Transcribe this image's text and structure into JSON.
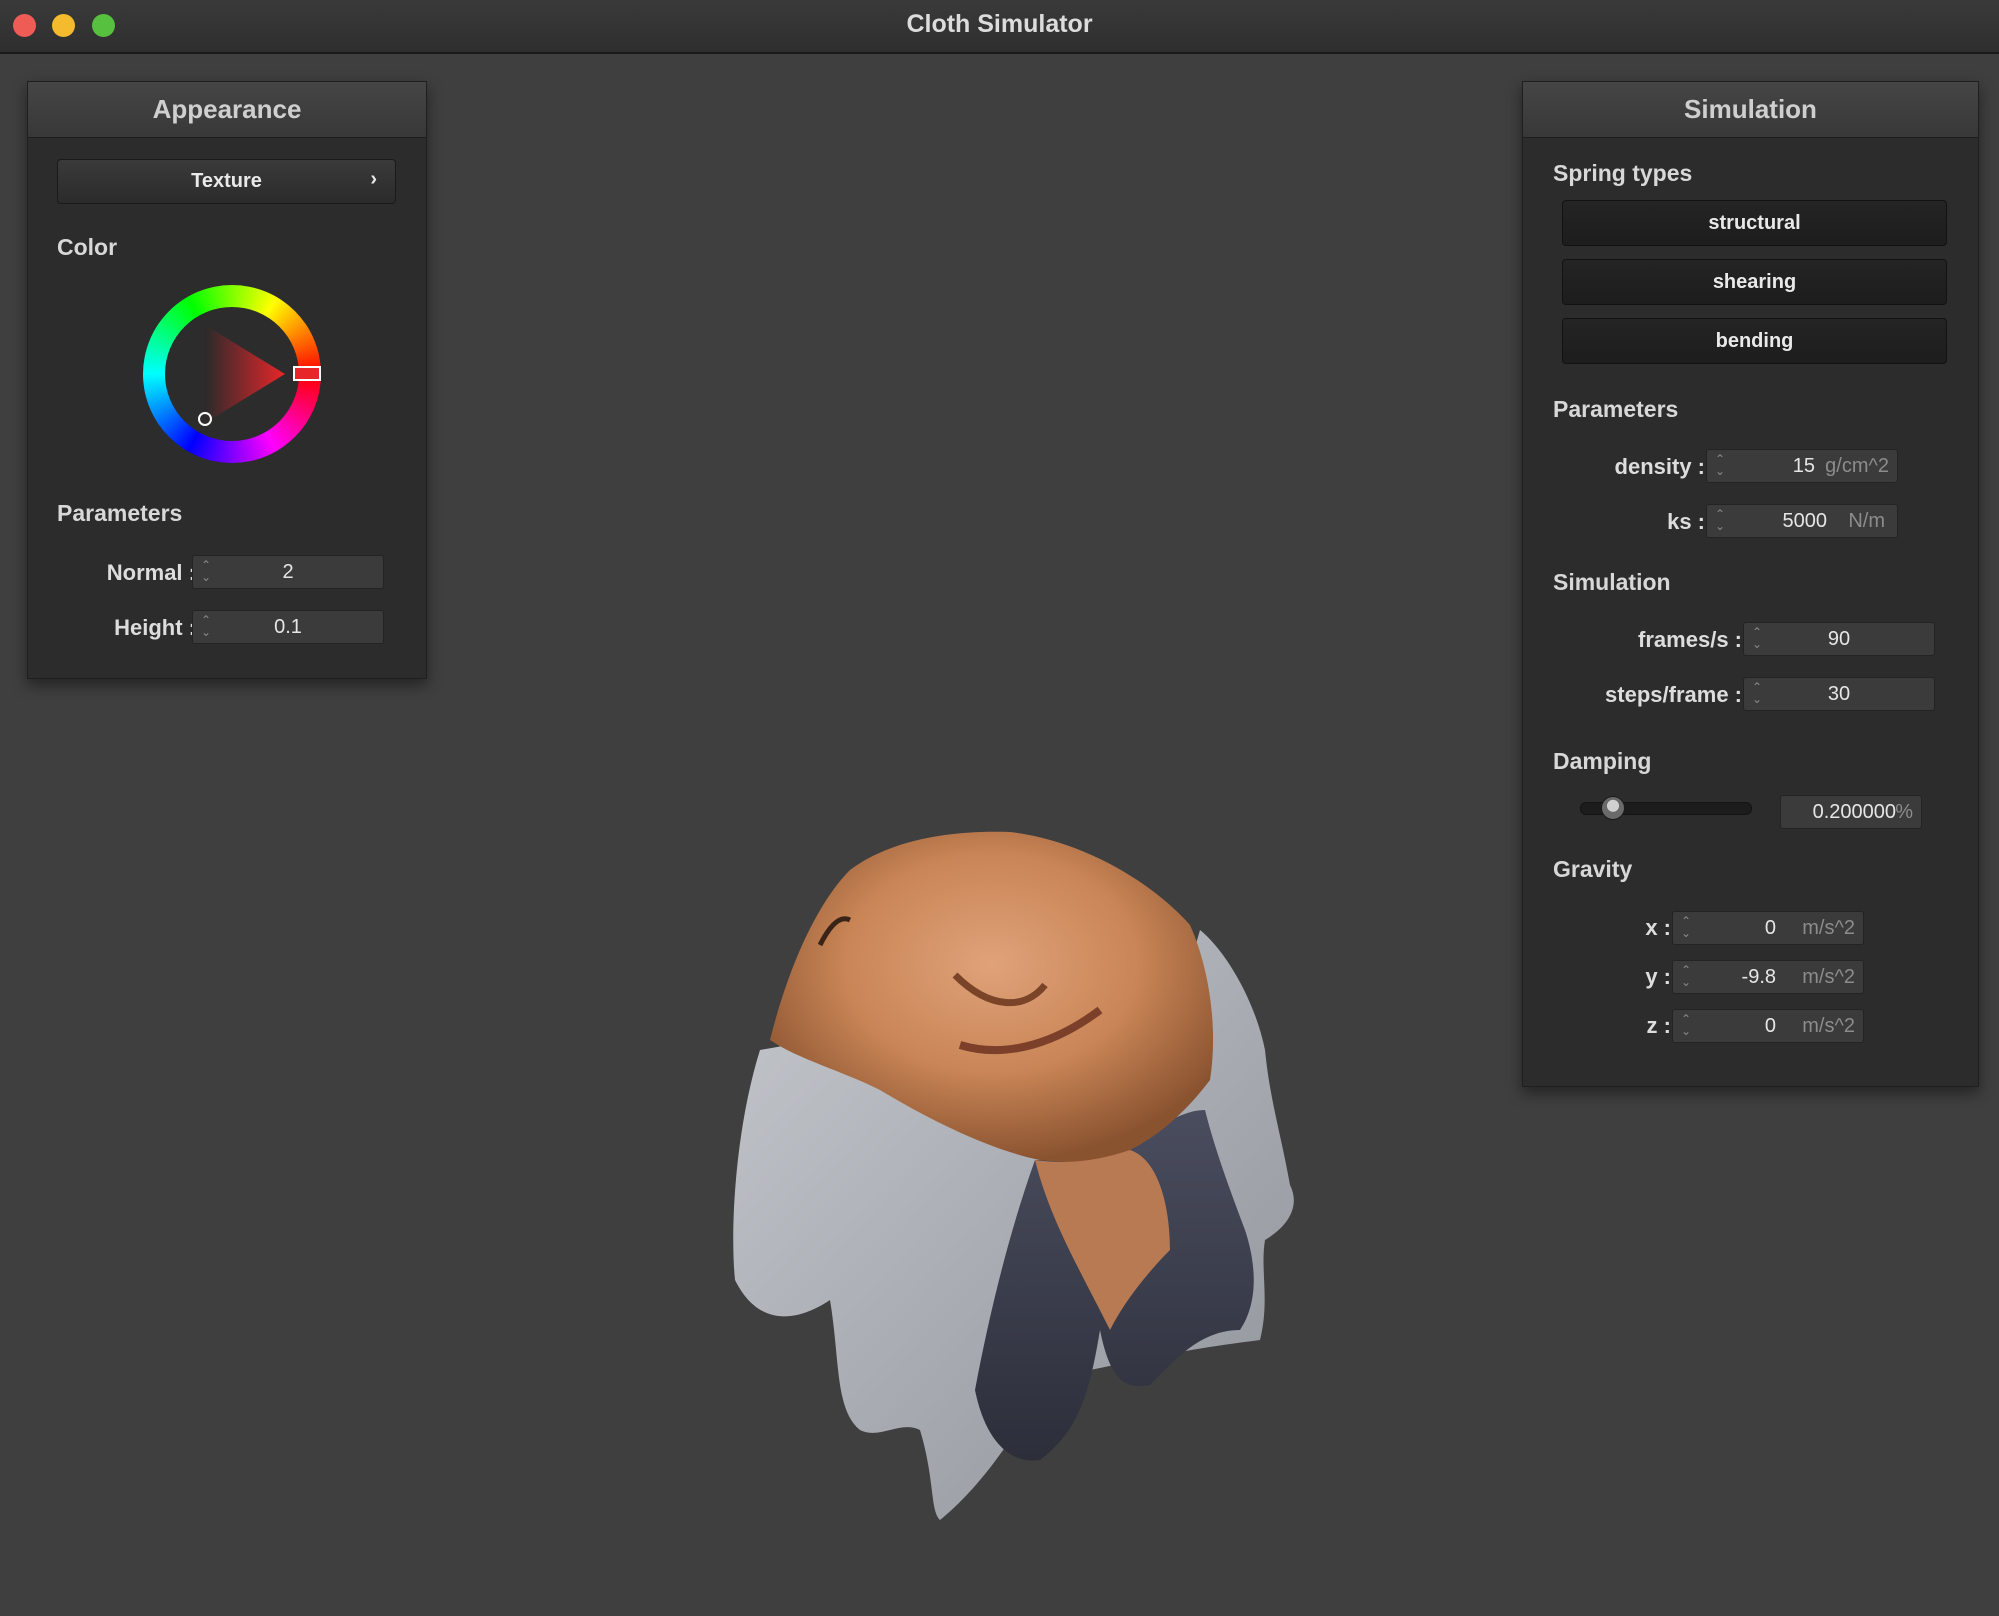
{
  "window": {
    "title": "Cloth Simulator"
  },
  "appearance": {
    "title": "Appearance",
    "texture_button": "Texture",
    "texture_chevron": "›",
    "color_label": "Color",
    "color": {
      "selected_hex": "#e8262a"
    },
    "parameters_label": "Parameters",
    "normal": {
      "label": "Normal :",
      "value": "2"
    },
    "height": {
      "label": "Height :",
      "value": "0.1"
    }
  },
  "simulation": {
    "title": "Simulation",
    "spring_types_label": "Spring types",
    "spring_types": [
      "structural",
      "shearing",
      "bending"
    ],
    "parameters_label": "Parameters",
    "density": {
      "label": "density :",
      "value": "15",
      "unit": "g/cm^2"
    },
    "ks": {
      "label": "ks :",
      "value": "5000",
      "unit": "N/m"
    },
    "simulation_label": "Simulation",
    "frames": {
      "label": "frames/s :",
      "value": "90"
    },
    "steps": {
      "label": "steps/frame :",
      "value": "30"
    },
    "damping_label": "Damping",
    "damping": {
      "value": "0.200000",
      "unit": "%",
      "slider_fraction": 0.2
    },
    "gravity_label": "Gravity",
    "gravity": {
      "x": {
        "label": "x :",
        "value": "0",
        "unit": "m/s^2"
      },
      "y": {
        "label": "y :",
        "value": "-9.8",
        "unit": "m/s^2"
      },
      "z": {
        "label": "z :",
        "value": "0",
        "unit": "m/s^2"
      }
    }
  },
  "viewport": {
    "object": "textured-cloth-on-sphere"
  }
}
